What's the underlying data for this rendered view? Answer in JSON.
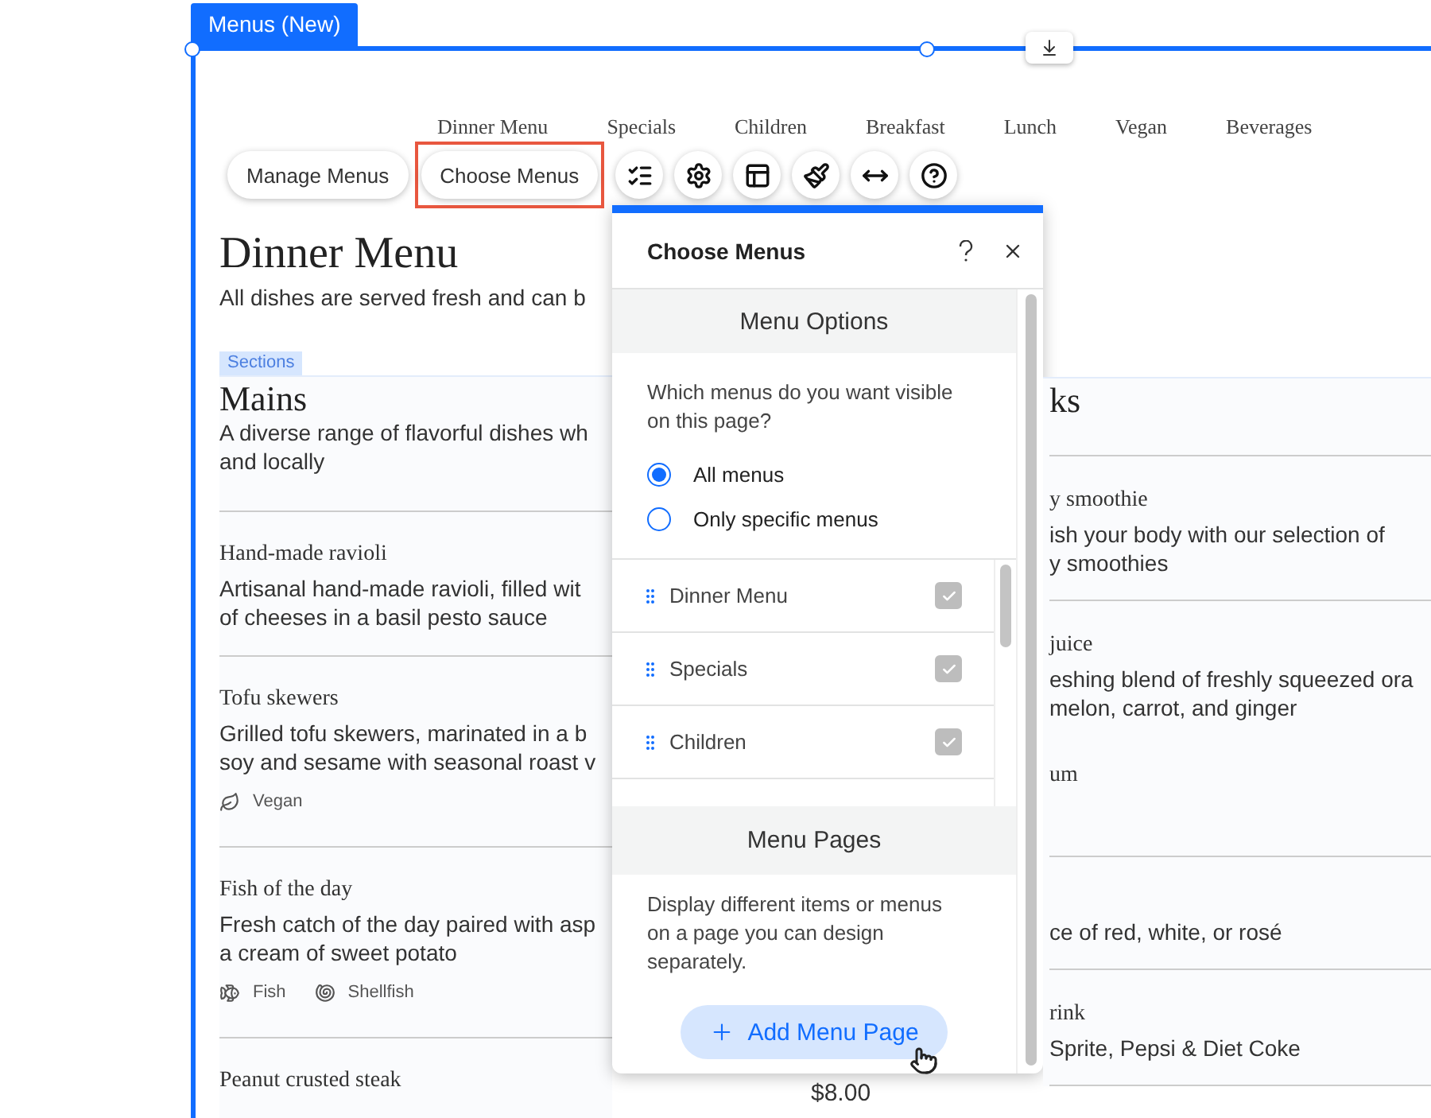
{
  "editor": {
    "tag": "Menus (New)"
  },
  "menu_tabs": [
    "Dinner Menu",
    "Specials",
    "Children",
    "Breakfast",
    "Lunch",
    "Vegan",
    "Beverages"
  ],
  "toolbar": {
    "buttons": [
      {
        "label": "Manage Menus",
        "selected": false
      },
      {
        "label": "Choose Menus",
        "selected": true
      }
    ]
  },
  "page": {
    "title": "Dinner Menu",
    "subtitle": "All dishes are served fresh and can b",
    "sections_tag": "Sections"
  },
  "left_section": {
    "title": "Mains",
    "description": [
      "A diverse range of flavorful dishes wh",
      "and locally"
    ],
    "items": [
      {
        "name": "Hand-made ravioli",
        "description": [
          "Artisanal hand-made ravioli, filled wit",
          "of cheeses in a basil pesto sauce"
        ]
      },
      {
        "name": "Tofu skewers",
        "description": [
          "Grilled tofu skewers, marinated in a b",
          "soy and sesame with seasonal roast v"
        ],
        "tags": [
          {
            "kind": "vegan",
            "label": "Vegan"
          }
        ]
      },
      {
        "name": "Fish of the day",
        "description": [
          "Fresh catch of the day paired with asp",
          "a cream of sweet potato"
        ],
        "tags": [
          {
            "kind": "fish",
            "label": "Fish"
          },
          {
            "kind": "shellfish",
            "label": "Shellfish"
          }
        ]
      },
      {
        "name": "Peanut crusted steak"
      }
    ]
  },
  "price": "$8.00",
  "right_section": {
    "title": "ks",
    "groups": [
      [
        {
          "name": "y smoothie",
          "description": [
            "ish your body with our selection of",
            "y smoothies"
          ]
        }
      ],
      [
        {
          "name": "juice",
          "description": [
            "eshing blend of freshly squeezed ora",
            "melon, carrot, and ginger"
          ]
        },
        {
          "name": "um"
        }
      ],
      [
        {
          "description": [
            "ce of red, white, or rosé"
          ]
        }
      ],
      [
        {
          "name": "rink",
          "description": [
            "Sprite, Pepsi & Diet Coke"
          ]
        }
      ]
    ]
  },
  "panel": {
    "title": "Choose Menus",
    "options_heading": "Menu Options",
    "question": "Which menus do you want visible on this page?",
    "radios": [
      {
        "label": "All menus",
        "selected": true
      },
      {
        "label": "Only specific menus",
        "selected": false
      }
    ],
    "menus": [
      {
        "label": "Dinner Menu",
        "checked": true
      },
      {
        "label": "Specials",
        "checked": true
      },
      {
        "label": "Children",
        "checked": true
      }
    ],
    "pages_heading": "Menu Pages",
    "pages_text": "Display different items or menus on a page you can design separately.",
    "add_button": "Add Menu Page"
  }
}
